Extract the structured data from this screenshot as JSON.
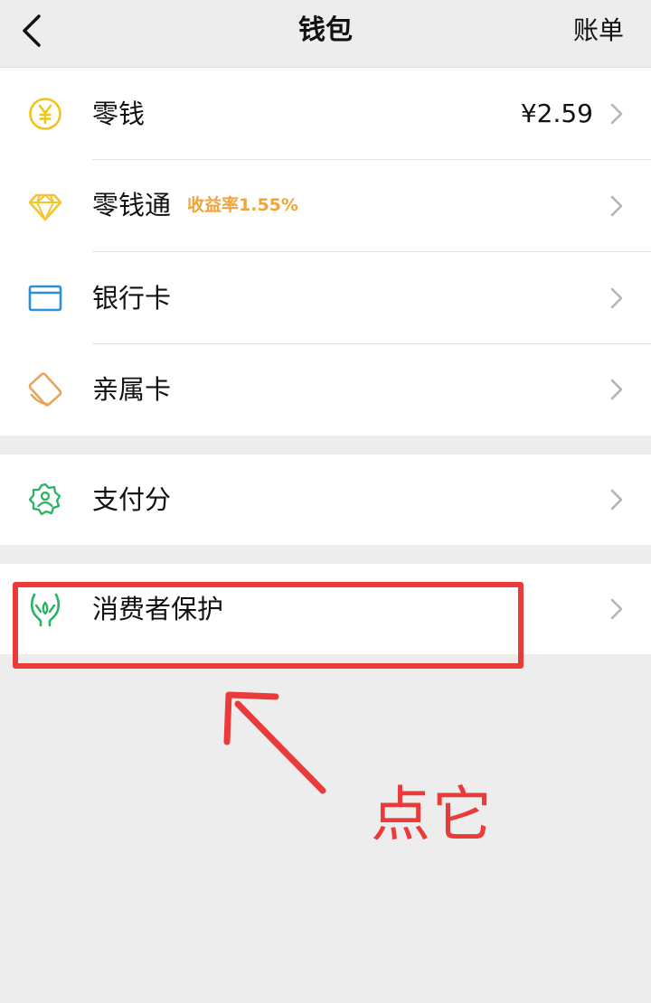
{
  "header": {
    "title": "钱包",
    "right_link": "账单",
    "back_icon": "back-chevron-icon"
  },
  "groups": [
    {
      "items": [
        {
          "label": "零钱",
          "value": "¥2.59",
          "icon": "yuan-coin-icon",
          "icon_color": "#f0c419"
        },
        {
          "label": "零钱通",
          "badge": "收益率1.55%",
          "icon": "diamond-icon",
          "icon_color": "#f4c431"
        },
        {
          "label": "银行卡",
          "icon": "bank-card-icon",
          "icon_color": "#2e8fd1"
        },
        {
          "label": "亲属卡",
          "icon": "family-card-icon",
          "icon_color": "#e5a55a"
        }
      ]
    },
    {
      "items": [
        {
          "label": "支付分",
          "icon": "pay-score-icon",
          "icon_color": "#28b463"
        }
      ]
    },
    {
      "items": [
        {
          "label": "消费者保护",
          "icon": "protect-hands-icon",
          "icon_color": "#28b463"
        }
      ]
    }
  ],
  "annotation": {
    "text": "点它",
    "color": "#ea3a3a"
  },
  "colors": {
    "background": "#ededed",
    "card": "#ffffff",
    "badge": "#f0a43a",
    "highlight": "#ea3a3a"
  }
}
